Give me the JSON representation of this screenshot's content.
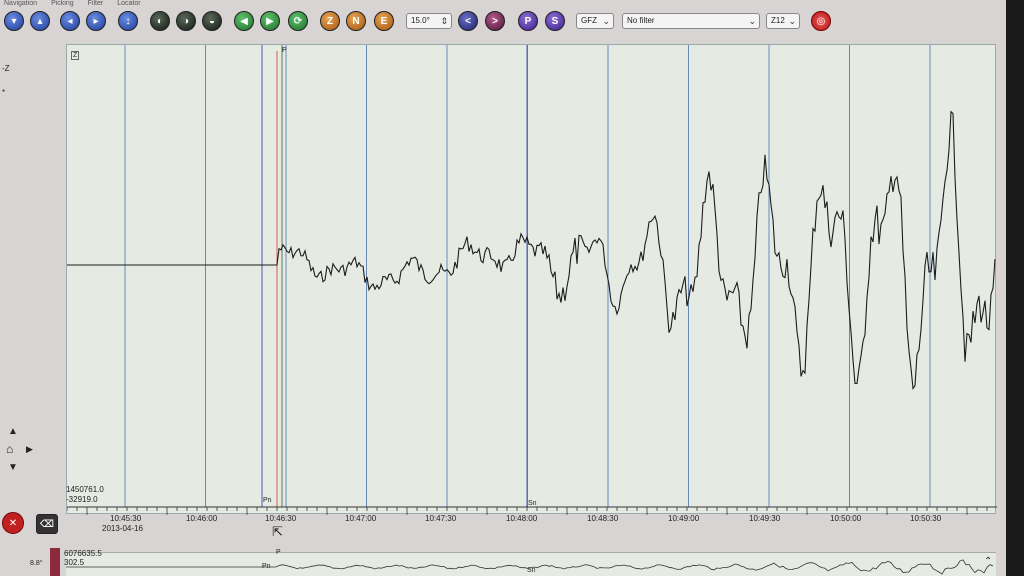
{
  "menu": [
    "Navigation",
    "Picking",
    "Filter",
    "Locator"
  ],
  "toolbar": {
    "zoom_value": "15.0°",
    "components": [
      "Z",
      "N",
      "E"
    ],
    "phase_buttons": [
      "P",
      "S"
    ],
    "network_select": "GFZ",
    "filter_select": "No filter",
    "channel_select": "Z12"
  },
  "left_panel": {
    "component_label": "-Z",
    "extra_label": "*"
  },
  "trace": {
    "z_label": "Z",
    "amp_max": "1450761.0",
    "amp_min": "-32919.0",
    "start_time": "10:45:30",
    "start_date": "2013-04-16",
    "time_ticks": [
      "10:46:00",
      "10:46:30",
      "10:47:00",
      "10:47:30",
      "10:48:00",
      "10:48:30",
      "10:49:00",
      "10:49:30",
      "10:50:00",
      "10:50:30"
    ],
    "picks": [
      {
        "label": "P",
        "position": "top"
      },
      {
        "label": "Pn",
        "position": "bottom"
      },
      {
        "label": "Sn",
        "position": "bottom"
      }
    ],
    "colors": {
      "pick_red": "#e05a4a",
      "pick_blue": "#4a5ab0",
      "grid": "#6a88bb",
      "trace": "#1c1c1c"
    }
  },
  "strip": {
    "value1": "6076635.5",
    "value2": "302.5",
    "scale_label": "8.8°",
    "pick_p": "P",
    "pick_pn": "Pn",
    "pick_sn": "Sn"
  }
}
